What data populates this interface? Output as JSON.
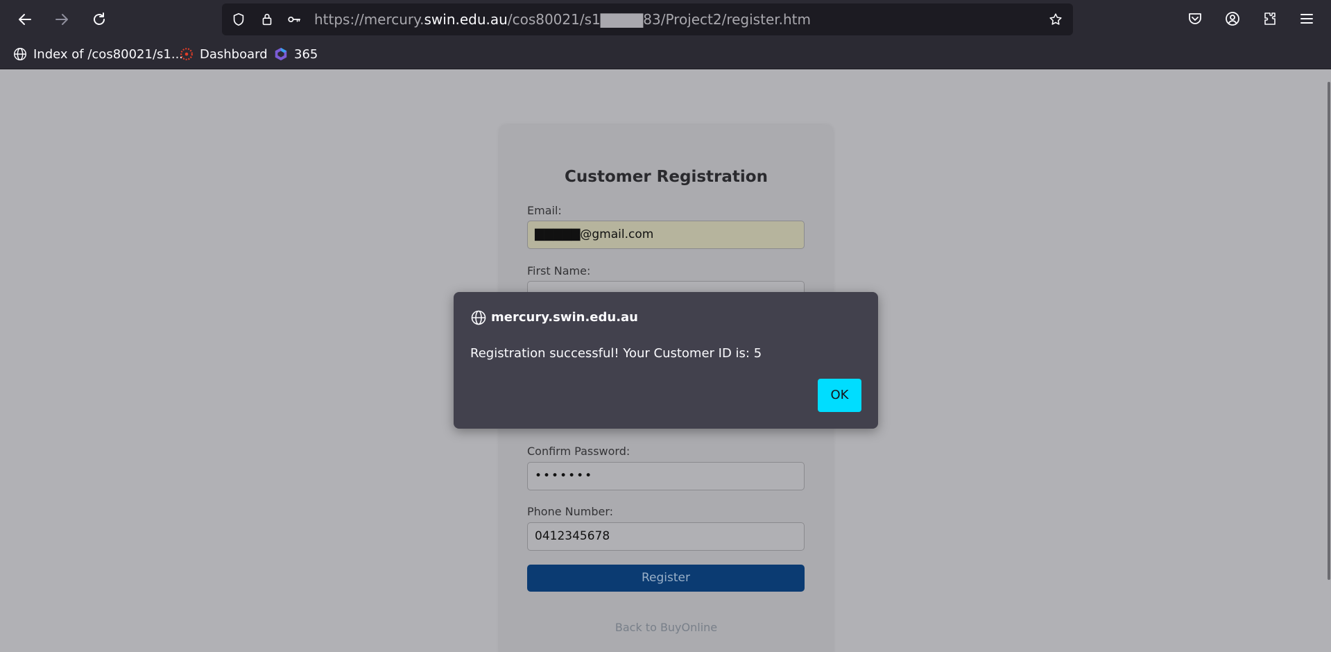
{
  "browser": {
    "url_prefix": "https://mercury.",
    "url_host": "swin.edu.au",
    "url_path": "/cos80021/s1▇▇▇▇83/Project2/register.htm",
    "bookmarks": [
      {
        "label": "Index of /cos80021/s1..."
      },
      {
        "label": "Dashboard"
      },
      {
        "label": "365"
      }
    ]
  },
  "form": {
    "title": "Customer Registration",
    "email_label": "Email:",
    "email_value": "▇▇▇▇▇@gmail.com",
    "first_name_label": "First Name:",
    "first_name_value": "",
    "confirm_password_label": "Confirm Password:",
    "confirm_password_value": "•••••••",
    "phone_label": "Phone Number:",
    "phone_value": "0412345678",
    "register_label": "Register",
    "back_link": "Back to BuyOnline"
  },
  "dialog": {
    "host": "mercury.swin.edu.au",
    "message": "Registration successful! Your Customer ID is: 5",
    "ok_label": "OK"
  },
  "colors": {
    "chrome_bg": "#2b2a33",
    "dialog_bg": "#42414d",
    "ok_button": "#00ddff",
    "register_button": "#0b3b72"
  }
}
